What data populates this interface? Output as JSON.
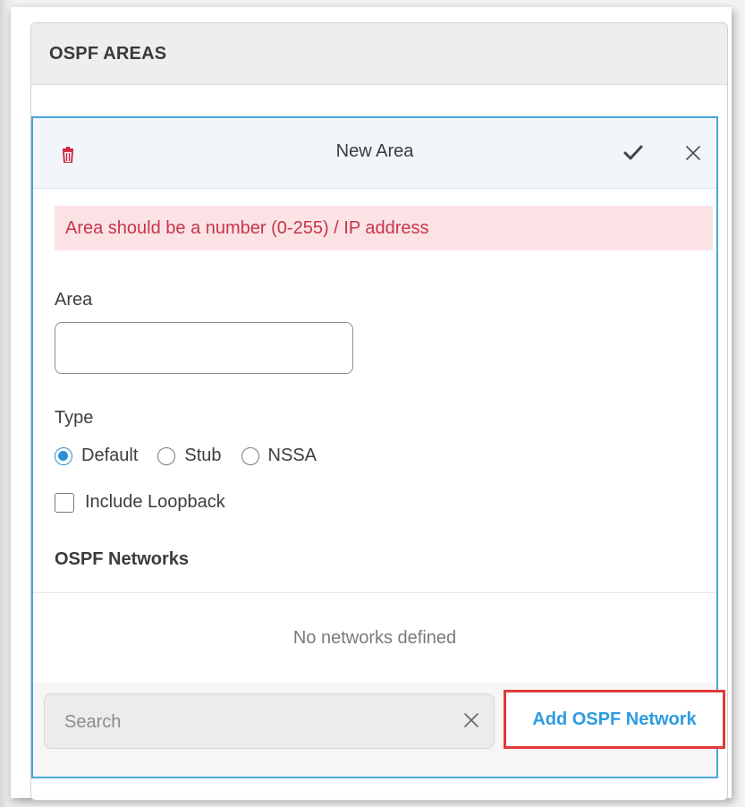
{
  "panel": {
    "title": "OSPF AREAS"
  },
  "area_card": {
    "title": "New Area",
    "error_message": "Area should be a number (0-255) / IP address",
    "area_label": "Area",
    "area_value": "",
    "type_label": "Type",
    "type_options": [
      {
        "label": "Default",
        "checked": true
      },
      {
        "label": "Stub",
        "checked": false
      },
      {
        "label": "NSSA",
        "checked": false
      }
    ],
    "include_loopback_label": "Include Loopback",
    "include_loopback_checked": false,
    "networks_title": "OSPF Networks",
    "networks_empty": "No networks defined",
    "search_placeholder": "Search",
    "add_network_label": "Add OSPF Network"
  },
  "colors": {
    "accent": "#2d9be0",
    "error_text": "#c7354a",
    "error_bg": "#fbe3e5",
    "highlight_border": "#e03a3a",
    "trash": "#d0203a"
  },
  "icons": [
    "trash-icon",
    "check-icon",
    "close-icon",
    "clear-search-icon"
  ]
}
